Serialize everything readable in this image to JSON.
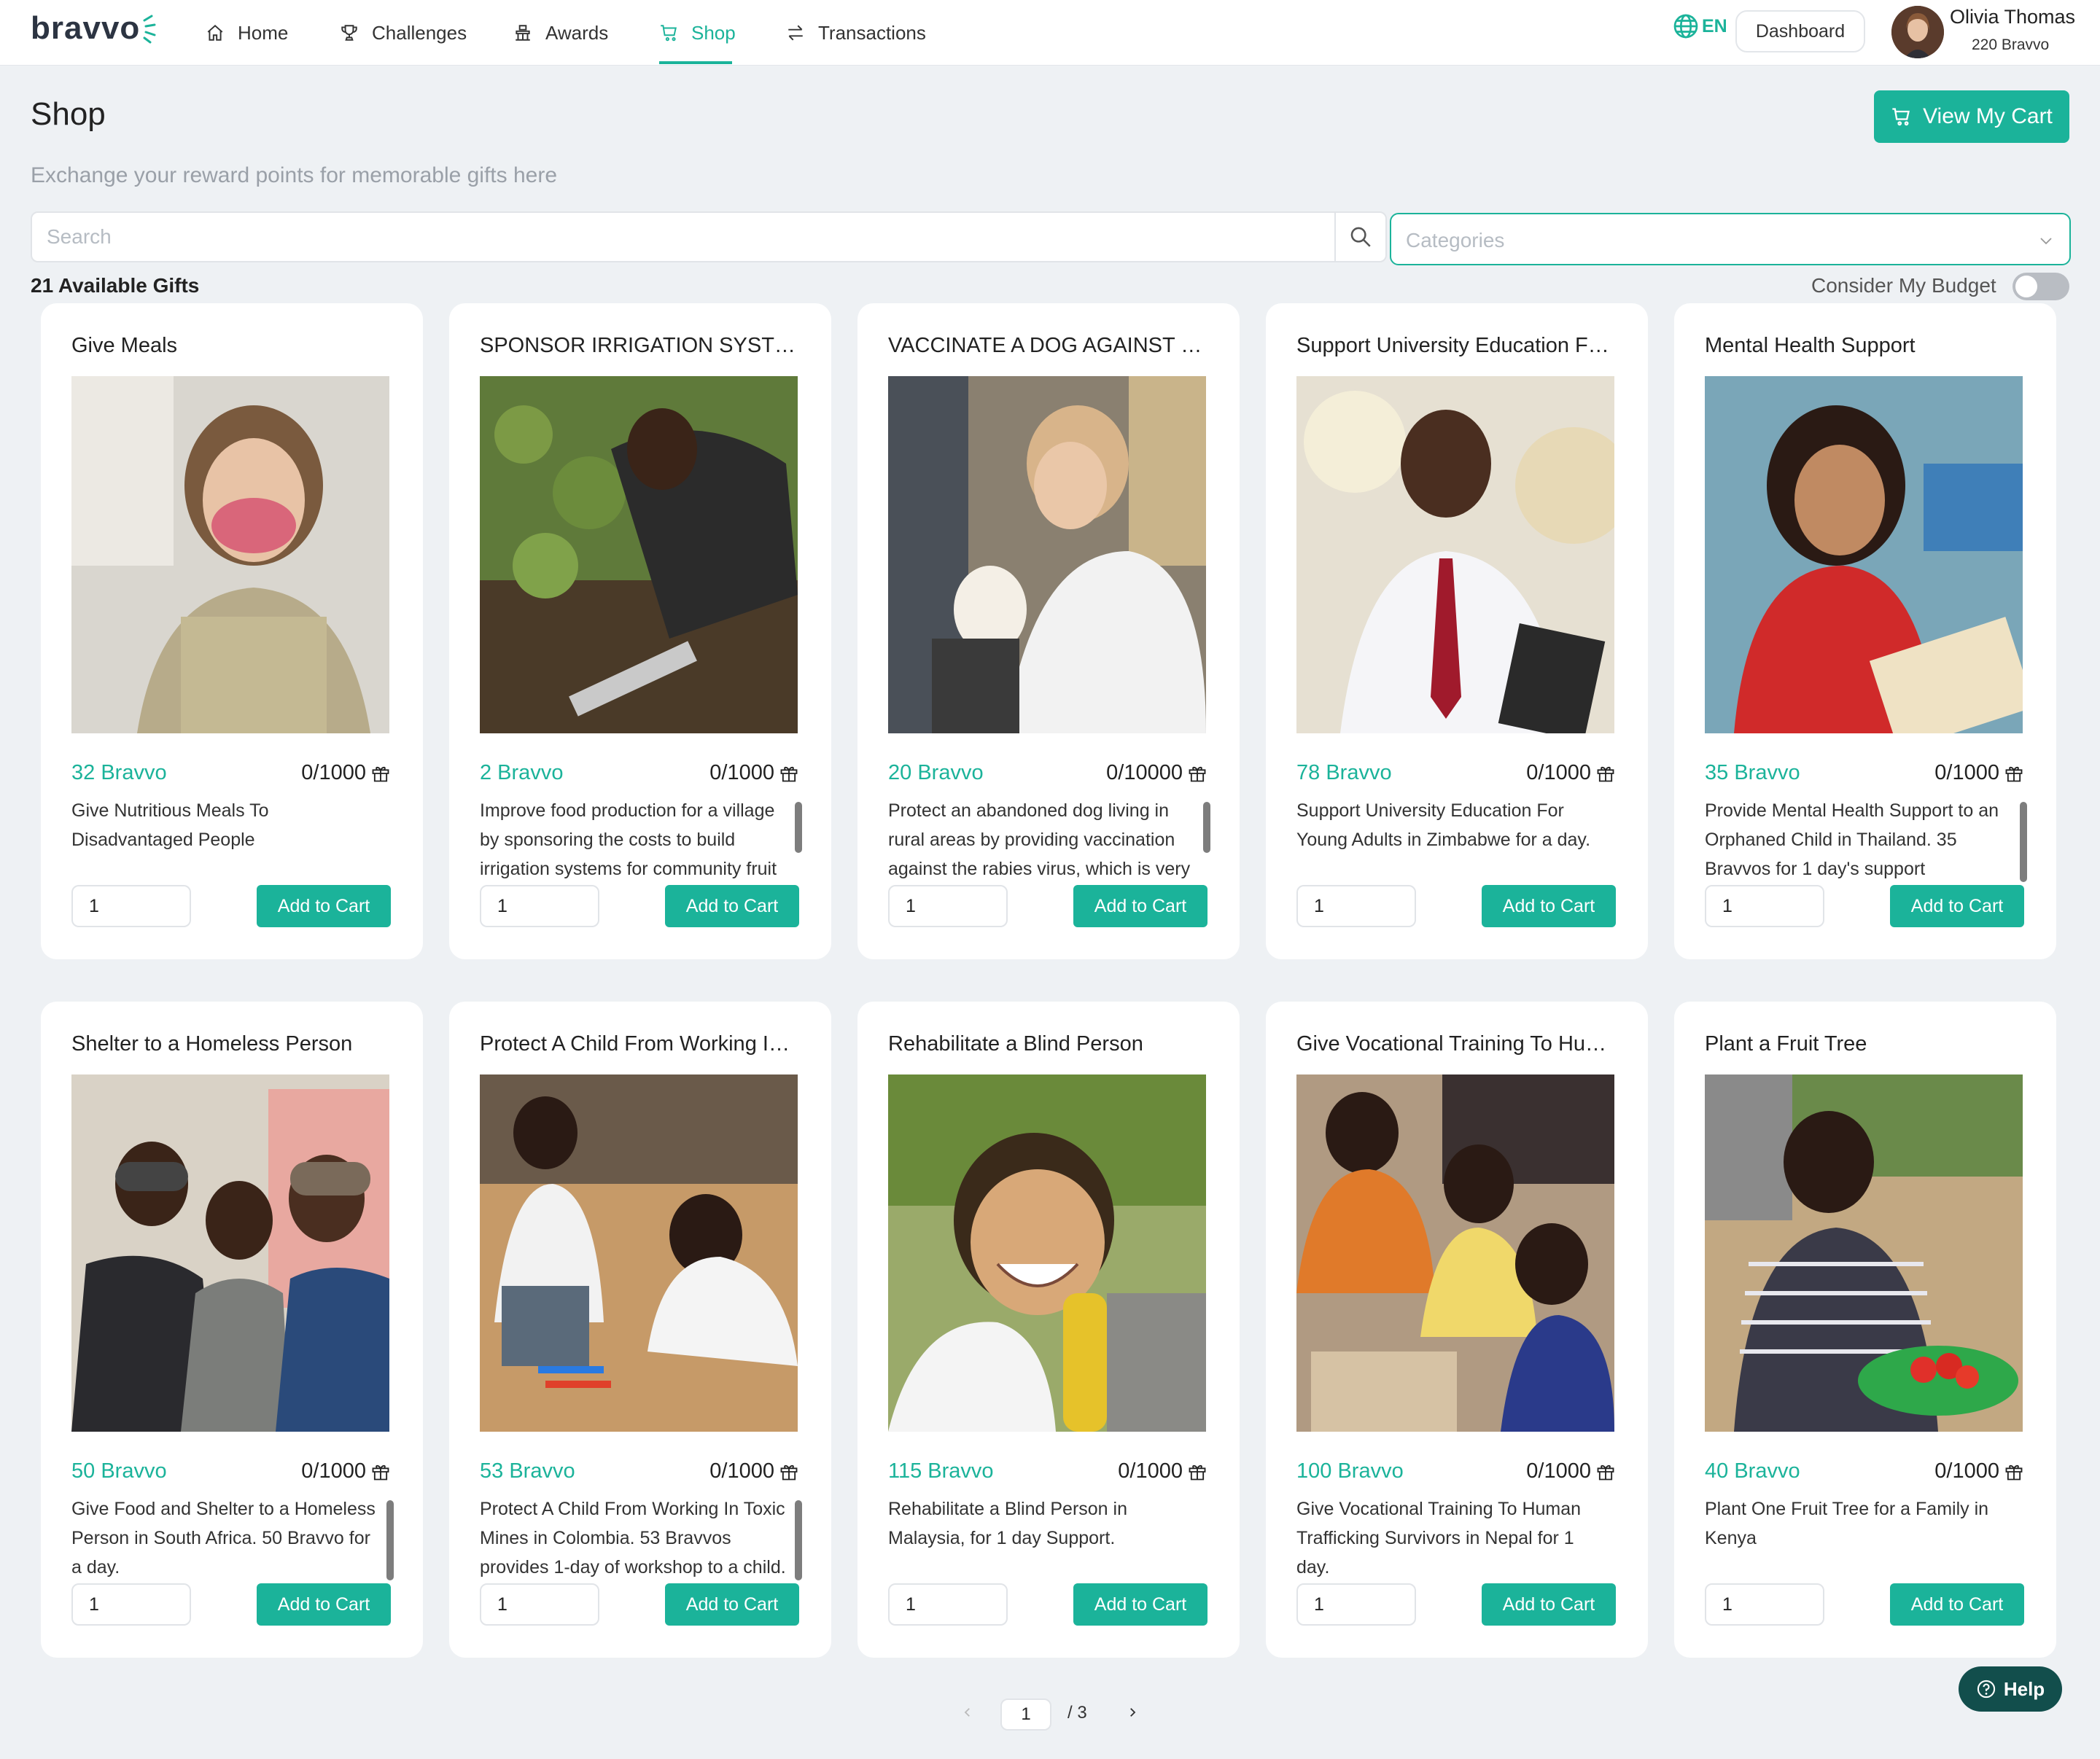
{
  "nav": {
    "logo": "bravvo",
    "items": [
      {
        "label": "Home",
        "icon": "home-icon"
      },
      {
        "label": "Challenges",
        "icon": "trophy-icon"
      },
      {
        "label": "Awards",
        "icon": "awards-icon"
      },
      {
        "label": "Shop",
        "icon": "shopping-cart-icon",
        "active": true
      },
      {
        "label": "Transactions",
        "icon": "transactions-icon"
      }
    ],
    "language": "EN",
    "dashboard_label": "Dashboard",
    "user": {
      "name": "Olivia Thomas",
      "points": "220 Bravvo"
    }
  },
  "header": {
    "title": "Shop",
    "subtitle": "Exchange your reward points for memorable gifts here",
    "cart_label": "View My Cart"
  },
  "filters": {
    "search_placeholder": "Search",
    "categories_placeholder": "Categories",
    "available_label": "21 Available Gifts",
    "budget_label": "Consider My Budget",
    "budget_on": false
  },
  "cards": [
    {
      "title": "Give Meals",
      "price": "32 Bravvo",
      "stock": "0/1000",
      "desc": "Give Nutritious Meals To Disadvantaged People",
      "qty": "1",
      "add_label": "Add to Cart"
    },
    {
      "title": "SPONSOR IRRIGATION SYSTEM…",
      "price": "2 Bravvo",
      "stock": "0/1000",
      "desc": "Improve food production for a village by sponsoring the costs to build irrigation systems for community fruit",
      "qty": "1",
      "add_label": "Add to Cart"
    },
    {
      "title": "VACCINATE A DOG AGAINST RA…",
      "price": "20 Bravvo",
      "stock": "0/10000",
      "desc": "Protect an abandoned dog living in rural areas by providing vaccination against the rabies virus, which is very",
      "qty": "1",
      "add_label": "Add to Cart"
    },
    {
      "title": "Support University Education Fo…",
      "price": "78 Bravvo",
      "stock": "0/1000",
      "desc": "Support University Education For Young Adults in Zimbabwe for a day.",
      "qty": "1",
      "add_label": "Add to Cart"
    },
    {
      "title": "Mental Health Support",
      "price": "35 Bravvo",
      "stock": "0/1000",
      "desc": "Provide Mental Health Support to an Orphaned Child in Thailand. 35 Bravvos for 1 day's support",
      "qty": "1",
      "add_label": "Add to Cart"
    },
    {
      "title": "Shelter to a Homeless Person",
      "price": "50 Bravvo",
      "stock": "0/1000",
      "desc": "Give Food and Shelter to a Homeless Person in South Africa. 50 Bravvo for a day.",
      "qty": "1",
      "add_label": "Add to Cart"
    },
    {
      "title": "Protect A Child From Working In …",
      "price": "53 Bravvo",
      "stock": "0/1000",
      "desc": "Protect A Child From Working In Toxic Mines in Colombia. 53 Bravvos provides 1-day of workshop to a child.",
      "qty": "1",
      "add_label": "Add to Cart"
    },
    {
      "title": "Rehabilitate a Blind Person",
      "price": "115 Bravvo",
      "stock": "0/1000",
      "desc": "Rehabilitate a Blind Person in Malaysia, for 1 day Support.",
      "qty": "1",
      "add_label": "Add to Cart"
    },
    {
      "title": "Give Vocational Training To Hum…",
      "price": "100 Bravvo",
      "stock": "0/1000",
      "desc": "Give Vocational Training To Human Trafficking Survivors in Nepal for 1 day.",
      "qty": "1",
      "add_label": "Add to Cart"
    },
    {
      "title": "Plant a Fruit Tree",
      "price": "40 Bravvo",
      "stock": "0/1000",
      "desc": "Plant One Fruit Tree for a Family in Kenya",
      "qty": "1",
      "add_label": "Add to Cart"
    }
  ],
  "pagination": {
    "current": "1",
    "total": "/ 3"
  },
  "help_label": "Help",
  "colors": {
    "accent": "#1bb39a",
    "help": "#124e4c"
  }
}
